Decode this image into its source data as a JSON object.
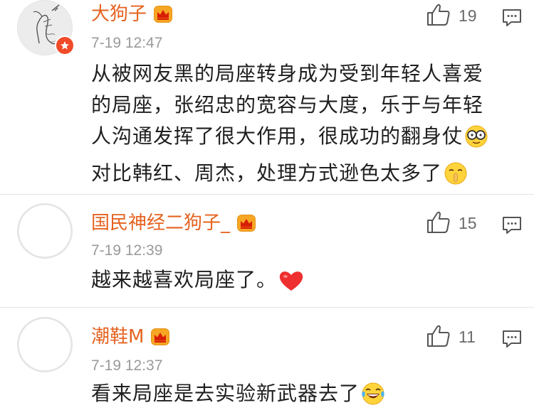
{
  "comments": [
    {
      "username": "大狗子",
      "time": "7-19 12:47",
      "likes": "19",
      "text_lines": [
        "从被网友黑的局座转身成为受到年轻人喜爱",
        "的局座，张绍忠的宽容与大度，乐于与年轻",
        "人沟通发挥了很大作用，很成功的翻身仗",
        "对比韩红、周杰，处理方式逊色太多了"
      ],
      "emojis": [
        "nerd-glasses-emoji",
        "shush-emoji"
      ],
      "vip_badge": "vip-crown-icon",
      "avatar": "sketch-avatar"
    },
    {
      "username": "国民神经二狗子_",
      "time": "7-19 12:39",
      "likes": "15",
      "text_lines": [
        "越来越喜欢局座了。"
      ],
      "emojis": [
        "heart-emoji"
      ],
      "vip_badge": "vip-crown-icon",
      "avatar": "default-avatar"
    },
    {
      "username": "潮鞋M",
      "time": "7-19 12:37",
      "likes": "11",
      "text_lines": [
        "看来局座是去实验新武器去了"
      ],
      "emojis": [
        "laughing-tears-emoji"
      ],
      "vip_badge": "vip-crown-icon",
      "avatar": "default-avatar"
    }
  ],
  "colors": {
    "username": "#e5621f",
    "timestamp": "#9a9a9a",
    "body": "#1f1f1f",
    "divider": "#e5e5e5",
    "verified_badge": "#f04a28"
  }
}
